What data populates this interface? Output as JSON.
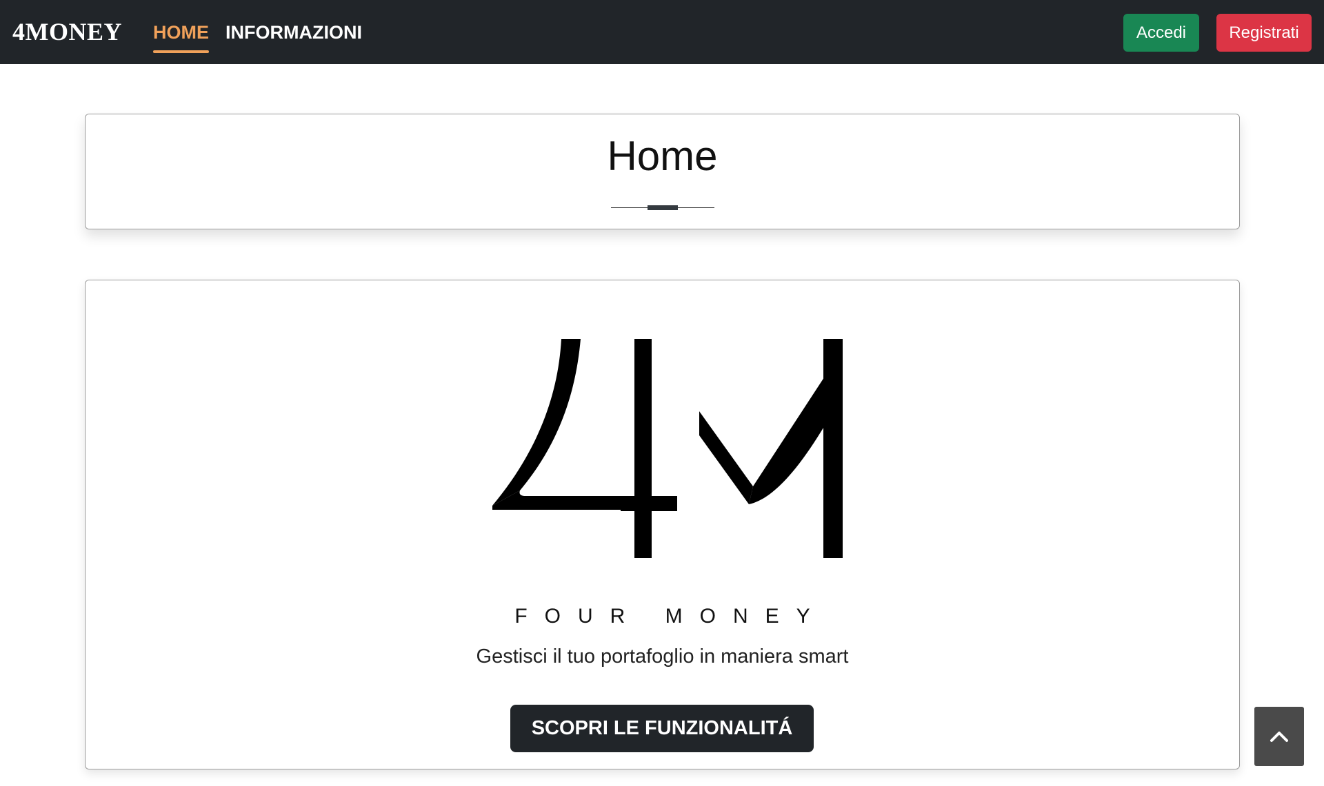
{
  "navbar": {
    "brand": "4MONEY",
    "links": [
      {
        "label": "HOME",
        "active": true
      },
      {
        "label": "INFORMAZIONI",
        "active": false
      }
    ],
    "login_label": "Accedi",
    "register_label": "Registrati"
  },
  "title_card": {
    "title": "Home"
  },
  "hero": {
    "logo_text": "4M",
    "tagline": "FOUR MONEY",
    "subtitle": "Gestisci il tuo portafoglio in maniera smart",
    "cta_label": "SCOPRI LE FUNZIONALITÁ"
  },
  "back_to_top": {
    "icon": "chevron-up-icon"
  },
  "colors": {
    "navbar_bg": "#212529",
    "nav_active": "#f0a15a",
    "login_button": "#198754",
    "register_button": "#dc3545",
    "cta_button": "#212529",
    "back_to_top": "#4a4a4a"
  }
}
